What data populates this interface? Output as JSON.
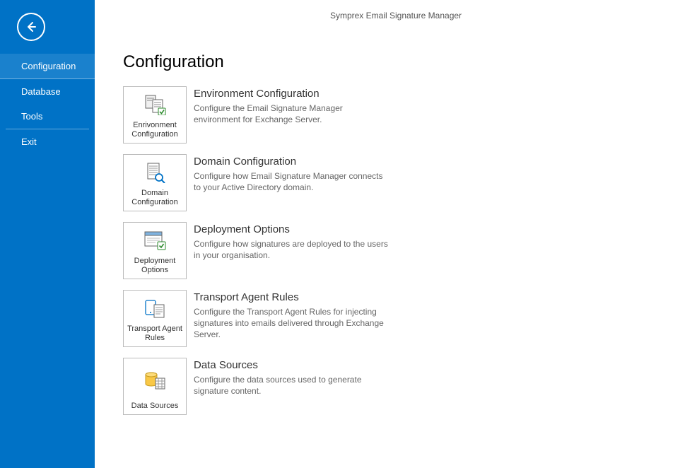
{
  "header": {
    "title": "Symprex Email Signature Manager"
  },
  "sidebar": {
    "nav": [
      {
        "label": "Configuration",
        "active": true
      },
      {
        "label": "Database",
        "active": false
      },
      {
        "label": "Tools",
        "active": false
      },
      {
        "label": "Exit",
        "active": false
      }
    ]
  },
  "page": {
    "title": "Configuration",
    "tiles": [
      {
        "icon": "servers-check",
        "tile_label": "Enrivonment Configuration",
        "title": "Environment Configuration",
        "desc": "Configure the Email Signature Manager environment for Exchange Server."
      },
      {
        "icon": "server-search",
        "tile_label": "Domain Configuration",
        "title": "Domain Configuration",
        "desc": "Configure how Email Signature Manager connects to your Active Directory domain."
      },
      {
        "icon": "window-check",
        "tile_label": "Deployment Options",
        "title": "Deployment Options",
        "desc": "Configure how signatures are deployed to the users in your organisation."
      },
      {
        "icon": "device-doc",
        "tile_label": "Transport Agent Rules",
        "title": "Transport Agent Rules",
        "desc": "Configure the Transport Agent Rules for injecting signatures into emails delivered through Exchange Server."
      },
      {
        "icon": "db-table",
        "tile_label": "Data Sources",
        "title": "Data Sources",
        "desc": "Configure the data sources used to generate signature content."
      }
    ]
  }
}
